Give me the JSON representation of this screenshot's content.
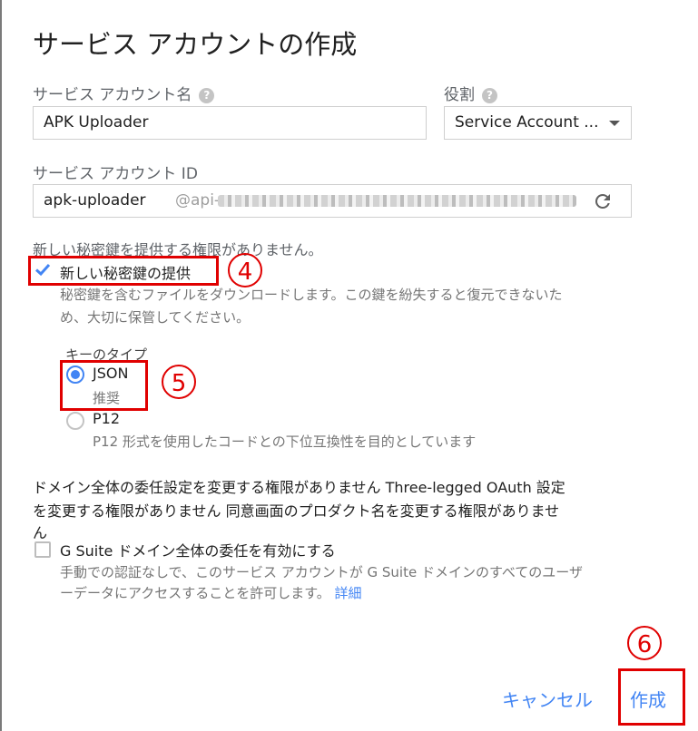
{
  "dialog": {
    "title": "サービス アカウントの作成",
    "account_name": {
      "label": "サービス アカウント名",
      "help_icon": "help-circle-icon",
      "value": "APK Uploader"
    },
    "role": {
      "label": "役割",
      "help_icon": "help-circle-icon",
      "selected": "Service Account ..."
    },
    "account_id": {
      "label": "サービス アカウント ID",
      "value": "apk-uploader",
      "domain_prefix": "@api-"
    },
    "key_section": {
      "no_permission": "新しい秘密鍵を提供する権限がありません。",
      "checkbox_label": "新しい秘密鍵の提供",
      "checkbox_checked": true,
      "description_line1": "秘密鍵を含むファイルをダウンロードします。この鍵を紛失すると復元できないた",
      "description_line2": "め、大切に保管してください。",
      "key_type_label": "キーのタイプ",
      "options": [
        {
          "label": "JSON",
          "sub": "推奨",
          "selected": true
        },
        {
          "label": "P12",
          "sub": "P12 形式を使用したコードとの下位互換性を目的としています",
          "selected": false
        }
      ]
    },
    "delegation": {
      "notice_line1": "ドメイン全体の委任設定を変更する権限がありません Three-legged OAuth 設定",
      "notice_line2": "を変更する権限がありません 同意画面のプロダクト名を変更する権限がありませ",
      "notice_line3": "ん",
      "checkbox_label": "G Suite ドメイン全体の委任を有効にする",
      "checkbox_checked": false,
      "description_line1": "手動での認証なしで、このサービス アカウントが G Suite ドメインのすべてのユーザ",
      "description_line2": "ーデータにアクセスすることを許可します。",
      "details_link": "詳細"
    },
    "buttons": {
      "cancel": "キャンセル",
      "create": "作成"
    },
    "annotations": {
      "step4": "4",
      "step5": "5",
      "step6": "6"
    },
    "colors": {
      "accent": "#4285f4",
      "annotation": "#e00000"
    }
  }
}
